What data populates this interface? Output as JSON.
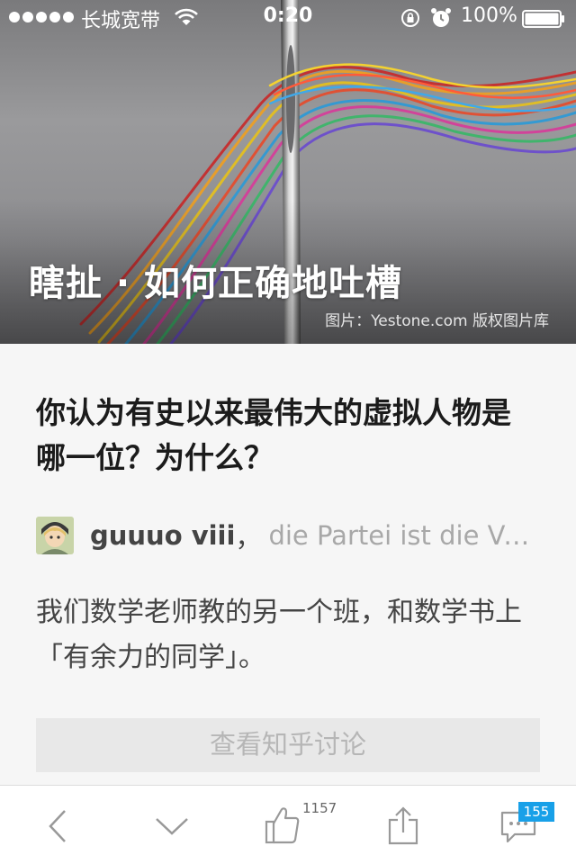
{
  "status_bar": {
    "carrier": "长城宽带",
    "time": "0:20",
    "battery": "100%"
  },
  "hero": {
    "title": "瞎扯 · 如何正确地吐槽",
    "credit": "图片：Yestone.com 版权图片库"
  },
  "question": {
    "title": "你认为有史以来最伟大的虚拟人物是哪一位？为什么？"
  },
  "answer": {
    "author_name": "guuuo viii",
    "author_separator": "，",
    "author_bio": "die Partei ist die Vor…",
    "text": "我们数学老师教的另一个班，和数学书上「有余力的同学」。"
  },
  "actions": {
    "view_discussion": "查看知乎讨论"
  },
  "toolbar": {
    "back_icon": "chevron-left-icon",
    "next_icon": "chevron-down-icon",
    "like_icon": "thumbs-up-icon",
    "like_count": "1157",
    "share_icon": "share-icon",
    "comment_icon": "comment-icon",
    "comment_count": "155"
  },
  "colors": {
    "badge": "#18a0e8",
    "background": "#f6f6f6"
  }
}
